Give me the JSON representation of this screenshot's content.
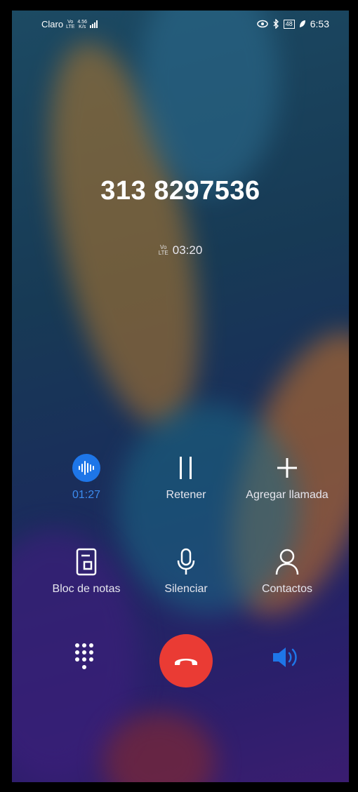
{
  "status_bar": {
    "carrier": "Claro",
    "network_tag_top": "Vo",
    "network_tag_bottom": "LTE",
    "data_tag_top": "4.56",
    "data_tag_bottom": "K/s",
    "battery": "48",
    "time": "6:53"
  },
  "call": {
    "number": "313 8297536",
    "lte_top": "Vo",
    "lte_bottom": "LTE",
    "duration": "03:20"
  },
  "controls": {
    "record_time": "01:27",
    "hold_label": "Retener",
    "add_call_label": "Agregar llamada",
    "notes_label": "Bloc de notas",
    "mute_label": "Silenciar",
    "contacts_label": "Contactos"
  },
  "colors": {
    "accent_blue": "#1e76e8",
    "end_call_red": "#ea3b34"
  },
  "icons": [
    "eye-icon",
    "bluetooth-icon",
    "battery-icon",
    "leaf-icon",
    "record-icon",
    "pause-icon",
    "plus-icon",
    "notes-icon",
    "microphone-icon",
    "contact-icon",
    "dialpad-icon",
    "end-call-icon",
    "speaker-icon"
  ]
}
